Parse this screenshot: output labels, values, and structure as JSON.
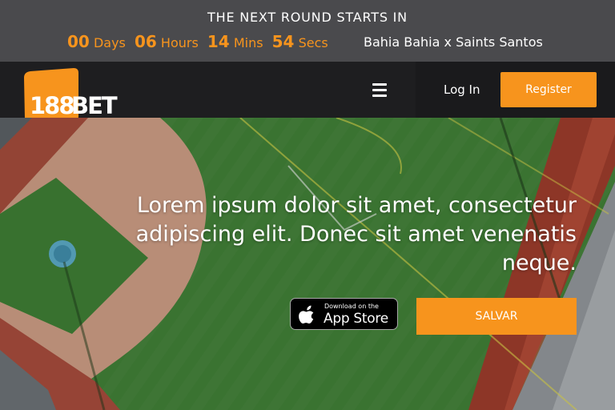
{
  "countdown": {
    "title": "THE NEXT ROUND STARTS IN",
    "days_value": "00",
    "days_label": "Days",
    "hours_value": "06",
    "hours_label": "Hours",
    "mins_value": "14",
    "mins_label": "Mins",
    "secs_value": "54",
    "secs_label": "Secs",
    "match": "Bahia Bahia x Saints Santos"
  },
  "header": {
    "logo_text_num": "188",
    "logo_text_word": "BET",
    "menu_icon": "hamburger-menu-icon",
    "login_label": "Log In",
    "register_label": "Register"
  },
  "hero": {
    "headline": "Lorem ipsum dolor sit amet, consectetur adipiscing elit. Donec sit amet venenatis neque.",
    "appstore_small": "Download on the",
    "appstore_big": "App Store",
    "cta_label": "SALVAR"
  },
  "colors": {
    "accent": "#f7941d",
    "countdown_bg": "#4a4a4d",
    "header_bg": "#1e1e20"
  }
}
